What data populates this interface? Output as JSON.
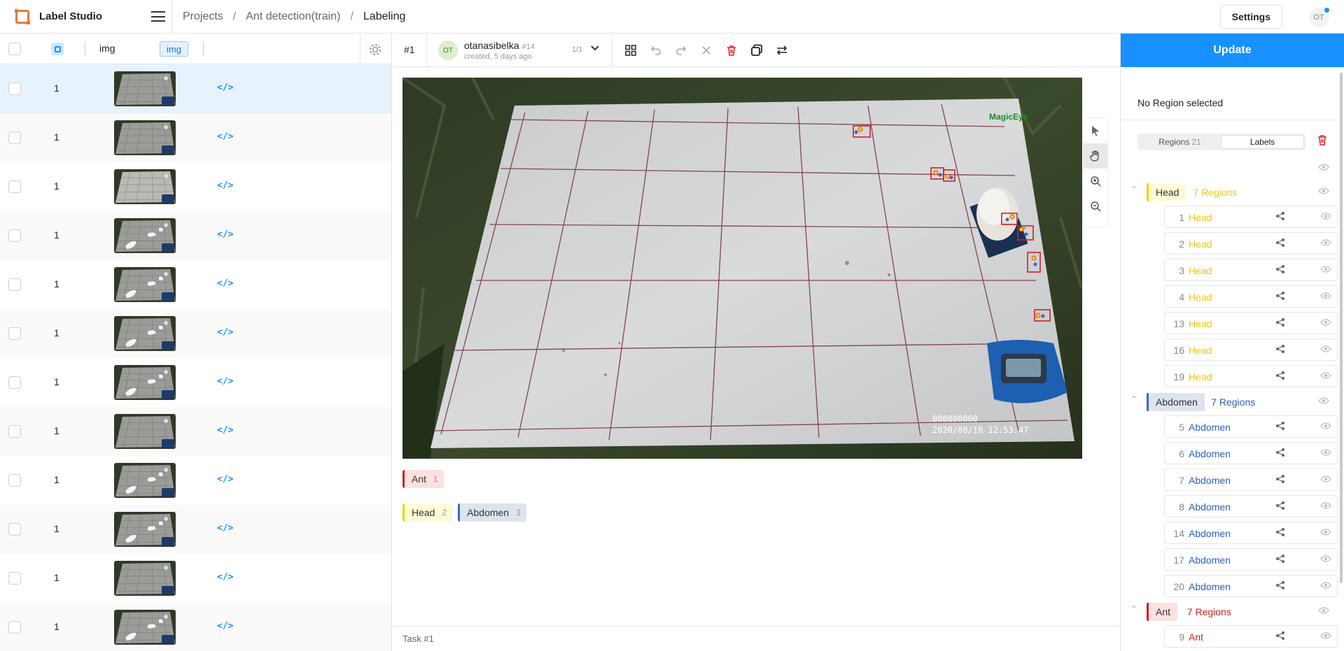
{
  "app": {
    "title": "Label Studio"
  },
  "breadcrumb": {
    "projects": "Projects",
    "sep": "/",
    "project": "Ant detection(train)",
    "page": "Labeling"
  },
  "header": {
    "settings_label": "Settings",
    "avatar": "OT"
  },
  "table": {
    "column_img": "img",
    "column_badge": "img",
    "rows": [
      {
        "count": "1",
        "code": "</>",
        "thumb": "plain"
      },
      {
        "count": "1",
        "code": "</>",
        "thumb": "plain"
      },
      {
        "count": "1",
        "code": "</>",
        "thumb": "light"
      },
      {
        "count": "1",
        "code": "</>",
        "thumb": "glare"
      },
      {
        "count": "1",
        "code": "</>",
        "thumb": "glare"
      },
      {
        "count": "1",
        "code": "</>",
        "thumb": "glare"
      },
      {
        "count": "1",
        "code": "</>",
        "thumb": "glare"
      },
      {
        "count": "1",
        "code": "</>",
        "thumb": "plain"
      },
      {
        "count": "1",
        "code": "</>",
        "thumb": "glare"
      },
      {
        "count": "1",
        "code": "</>",
        "thumb": "glare"
      },
      {
        "count": "1",
        "code": "</>",
        "thumb": "plain"
      },
      {
        "count": "1",
        "code": "</>",
        "thumb": "glare"
      }
    ]
  },
  "task": {
    "id": "#1",
    "annotator_initials": "OT",
    "annotator": "otanasibelka",
    "annotation_id": "#14",
    "created": "created, 5 days ago",
    "pager": "1/1",
    "footer": "Task #1"
  },
  "image": {
    "brand": "MagicEye",
    "counter": "000000000",
    "timestamp": "2020/08/18 12:53:47"
  },
  "labels": [
    {
      "name": "Ant",
      "hotkey": "1",
      "color": "#d02020"
    },
    {
      "name": "Head",
      "hotkey": "2",
      "color": "#f5d000"
    },
    {
      "name": "Abdomen",
      "hotkey": "3",
      "color": "#3a68c0"
    }
  ],
  "sidebar": {
    "update_label": "Update",
    "no_region": "No Region selected",
    "tab_regions": "Regions",
    "tab_regions_count": "21",
    "tab_labels": "Labels",
    "groups": [
      {
        "name": "Head",
        "count_label": "7 Regions",
        "color": "#f5d000",
        "text_color": "#f0c419",
        "items": [
          "1",
          "2",
          "3",
          "4",
          "13",
          "16",
          "19"
        ]
      },
      {
        "name": "Abdomen",
        "count_label": "7 Regions",
        "color": "#3a68c0",
        "text_color": "#2b5fb8",
        "items": [
          "5",
          "6",
          "7",
          "8",
          "14",
          "17",
          "20"
        ]
      },
      {
        "name": "Ant",
        "count_label": "7 Regions",
        "color": "#d02020",
        "text_color": "#d02020",
        "items": [
          "9"
        ]
      }
    ]
  }
}
